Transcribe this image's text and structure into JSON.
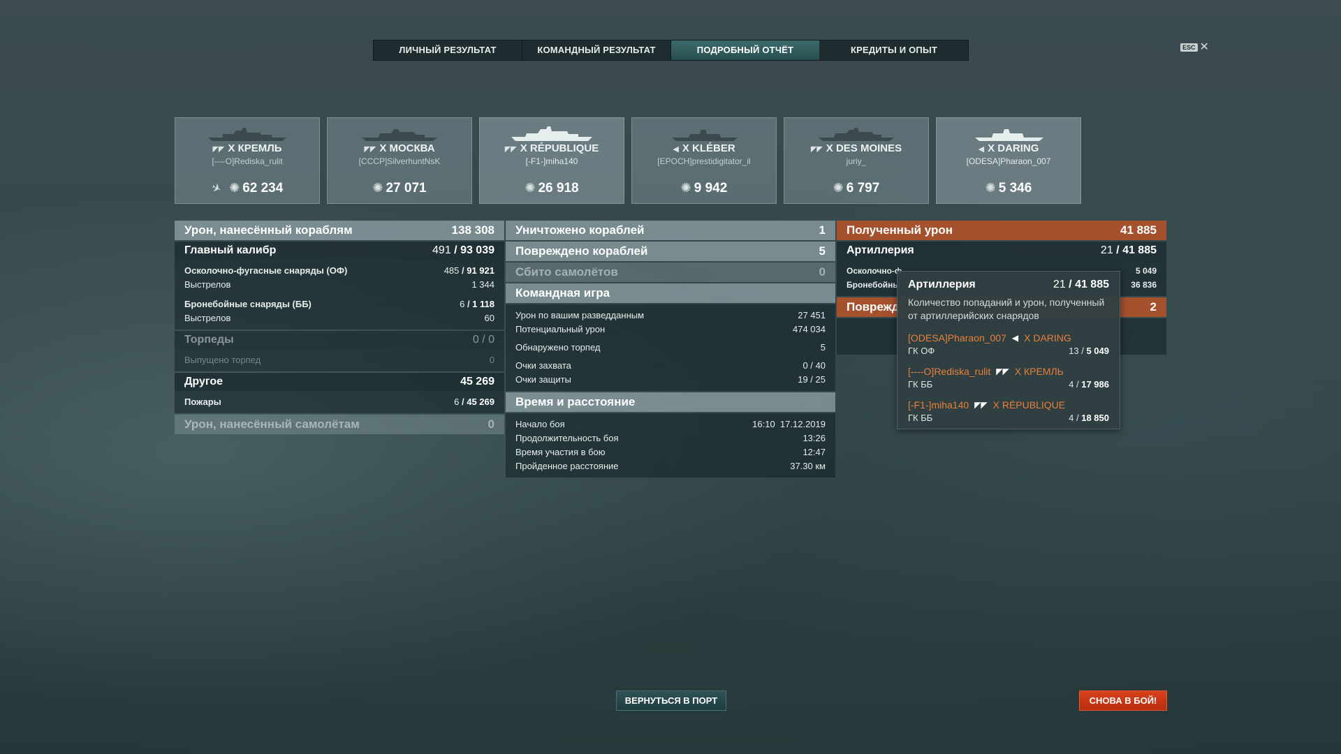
{
  "tabs": [
    {
      "label": "ЛИЧНЫЙ РЕЗУЛЬТАТ"
    },
    {
      "label": "КОМАНДНЫЙ РЕЗУЛЬТАТ"
    },
    {
      "label": "ПОДРОБНЫЙ ОТЧЁТ",
      "active": true
    },
    {
      "label": "КРЕДИТЫ И ОПЫТ"
    }
  ],
  "esc": {
    "key": "ESC",
    "close": "✕"
  },
  "ships": [
    {
      "name": "X КРЕМЛЬ",
      "class_icon": "battleship-icon",
      "player": "[----O]Rediska_rulit",
      "damage": "62 234"
    },
    {
      "name": "X МОСКВА",
      "class_icon": "cruiser-icon",
      "player": "[CCCP]SilverhuntNsK",
      "damage": "27 071"
    },
    {
      "name": "X RÉPUBLIQUE",
      "class_icon": "battleship-icon",
      "player": "[-F1-]miha140",
      "damage": "26 918"
    },
    {
      "name": "X KLÉBER",
      "class_icon": "destroyer-icon",
      "player": "[EPOCH]prestidigitator_il",
      "damage": "9 942"
    },
    {
      "name": "X DES MOINES",
      "class_icon": "cruiser-icon",
      "player": "juriy_",
      "damage": "6 797"
    },
    {
      "name": "X DARING",
      "class_icon": "destroyer-icon",
      "player": "[ODESA]Pharaon_007",
      "damage": "5 346"
    }
  ],
  "col1": {
    "damage_ships": {
      "label": "Урон, нанесённый кораблям",
      "value": "138 308"
    },
    "main_caliber": {
      "label": "Главный калибр",
      "hits": "491",
      "dmg": "93 039"
    },
    "he": {
      "label": "Осколочно-фугасные снаряды (ОФ)",
      "hits": "485",
      "dmg": "91 921",
      "shots_label": "Выстрелов",
      "shots": "1 344"
    },
    "ap": {
      "label": "Бронебойные снаряды (ББ)",
      "hits": "6",
      "dmg": "1 118",
      "shots_label": "Выстрелов",
      "shots": "60"
    },
    "torpedoes": {
      "label": "Торпеды",
      "value": "0 / 0",
      "launched_label": "Выпущено торпед",
      "launched": "0"
    },
    "other": {
      "label": "Другое",
      "value": "45 269"
    },
    "fires": {
      "label": "Пожары",
      "count": "6",
      "dmg": "45 269"
    },
    "damage_planes": {
      "label": "Урон, нанесённый самолётам",
      "value": "0"
    }
  },
  "col2": {
    "destroyed": {
      "label": "Уничтожено кораблей",
      "value": "1"
    },
    "damaged": {
      "label": "Повреждено кораблей",
      "value": "5"
    },
    "planes": {
      "label": "Сбито самолётов",
      "value": "0"
    },
    "team_play": {
      "label": "Командная игра"
    },
    "spot_dmg": {
      "label": "Урон по вашим разведданным",
      "value": "27 451"
    },
    "potential": {
      "label": "Потенциальный урон",
      "value": "474 034"
    },
    "torp_spotted": {
      "label": "Обнаружено торпед",
      "value": "5"
    },
    "capture": {
      "label": "Очки захвата",
      "value": "0 / 40"
    },
    "defense": {
      "label": "Очки защиты",
      "value": "19 / 25"
    },
    "time_distance": {
      "label": "Время и расстояние"
    },
    "start": {
      "label": "Начало боя",
      "value": "16:10  17.12.2019"
    },
    "duration": {
      "label": "Продолжительность боя",
      "value": "13:26"
    },
    "participation": {
      "label": "Время участия в бою",
      "value": "12:47"
    },
    "distance": {
      "label": "Пройденное расстояние",
      "value": "37.30 км"
    }
  },
  "col3": {
    "received": {
      "label": "Полученный урон",
      "value": "41 885"
    },
    "artillery": {
      "label": "Артиллерия",
      "hits": "21",
      "dmg": "41 885"
    },
    "he_partial": {
      "label": "Осколочно-ф",
      "value": "5 049"
    },
    "ap_partial": {
      "label": "Бронебойны",
      "value": "36 836"
    },
    "damaged_partial": {
      "label": "Поврежд",
      "value": "2"
    }
  },
  "tooltip": {
    "title": "Артиллерия",
    "hits": "21",
    "dmg": "41 885",
    "desc": "Количество попаданий и урон, полученный от артиллерийских снарядов",
    "entries": [
      {
        "player": "[ODESA]Pharaon_007",
        "ship": "X DARING",
        "icon": "destroyer-icon",
        "type": "ГК ОФ",
        "hits": "13",
        "dmg": "5 049"
      },
      {
        "player": "[----O]Rediska_rulit",
        "ship": "X КРЕМЛЬ",
        "icon": "battleship-icon",
        "type": "ГК ББ",
        "hits": "4",
        "dmg": "17 986"
      },
      {
        "player": "[-F1-]miha140",
        "ship": "X RÉPUBLIQUE",
        "icon": "battleship-icon",
        "type": "ГК ББ",
        "hits": "4",
        "dmg": "18 850"
      }
    ]
  },
  "buttons": {
    "port": "ВЕРНУТЬСЯ В ПОРТ",
    "battle": "СНОВА В БОЙ!"
  }
}
